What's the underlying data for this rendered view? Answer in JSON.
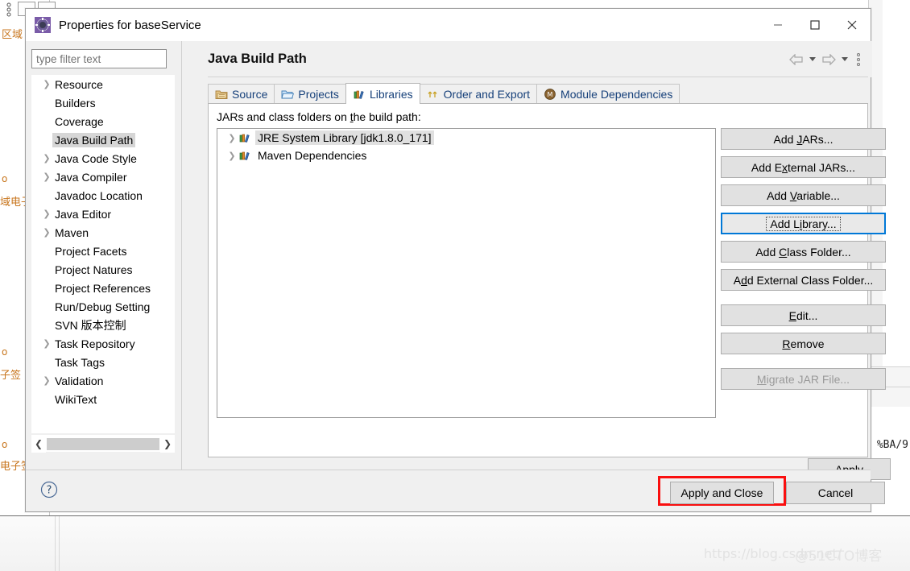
{
  "background": {
    "left_fragments": [
      "区域",
      "域电子",
      "子签",
      "电子签"
    ],
    "left_markers": [
      "o",
      "o",
      "o"
    ],
    "right_text": "%BA/9",
    "watermark": "https://blog.csdn.net/",
    "watermark_overlay": "@51CTO博客"
  },
  "dialog": {
    "title": "Properties for baseService",
    "title_icon": "properties-gear-icon",
    "window_controls": {
      "minimize": "minimize-icon",
      "maximize": "maximize-icon",
      "close": "close-icon"
    }
  },
  "sidebar": {
    "filter_placeholder": "type filter text",
    "filter_value": "",
    "items": [
      {
        "label": "Resource",
        "expandable": true,
        "selected": false
      },
      {
        "label": "Builders",
        "expandable": false,
        "selected": false
      },
      {
        "label": "Coverage",
        "expandable": false,
        "selected": false
      },
      {
        "label": "Java Build Path",
        "expandable": false,
        "selected": true
      },
      {
        "label": "Java Code Style",
        "expandable": true,
        "selected": false
      },
      {
        "label": "Java Compiler",
        "expandable": true,
        "selected": false
      },
      {
        "label": "Javadoc Location",
        "expandable": false,
        "selected": false
      },
      {
        "label": "Java Editor",
        "expandable": true,
        "selected": false
      },
      {
        "label": "Maven",
        "expandable": true,
        "selected": false
      },
      {
        "label": "Project Facets",
        "expandable": false,
        "selected": false
      },
      {
        "label": "Project Natures",
        "expandable": false,
        "selected": false
      },
      {
        "label": "Project References",
        "expandable": false,
        "selected": false
      },
      {
        "label": "Run/Debug Setting",
        "expandable": false,
        "selected": false
      },
      {
        "label": "SVN 版本控制",
        "expandable": false,
        "selected": false
      },
      {
        "label": "Task Repository",
        "expandable": true,
        "selected": false
      },
      {
        "label": "Task Tags",
        "expandable": false,
        "selected": false
      },
      {
        "label": "Validation",
        "expandable": true,
        "selected": false
      },
      {
        "label": "WikiText",
        "expandable": false,
        "selected": false
      }
    ]
  },
  "page": {
    "title": "Java Build Path",
    "nav": {
      "back": "back-arrow-icon",
      "back_menu": "chevron-down-icon",
      "forward": "forward-arrow-icon",
      "forward_menu": "chevron-down-icon",
      "overflow": "vertical-dots-icon"
    },
    "tabs": [
      {
        "label": "Source",
        "icon": "source-folder-icon",
        "active": false
      },
      {
        "label": "Projects",
        "icon": "open-folder-icon",
        "active": false
      },
      {
        "label": "Libraries",
        "icon": "library-books-icon",
        "active": true
      },
      {
        "label": "Order and Export",
        "icon": "order-arrows-icon",
        "active": false
      },
      {
        "label": "Module Dependencies",
        "icon": "module-badge-icon",
        "active": false
      }
    ],
    "list_label": "JARs and class folders on the build path:",
    "list_label_mnemonic": "t",
    "libraries": [
      {
        "label": "JRE System Library [jdk1.8.0_171]",
        "icon": "library-books-icon",
        "expandable": true,
        "selected": true
      },
      {
        "label": "Maven Dependencies",
        "icon": "library-books-icon",
        "expandable": true,
        "selected": false
      }
    ],
    "side_buttons": [
      {
        "label": "Add JARs...",
        "mnemonic": "J",
        "state": "normal",
        "gap_before": false
      },
      {
        "label": "Add External JARs...",
        "mnemonic": "x",
        "state": "normal",
        "gap_before": false
      },
      {
        "label": "Add Variable...",
        "mnemonic": "V",
        "state": "normal",
        "gap_before": false
      },
      {
        "label": "Add Library...",
        "mnemonic": "i",
        "state": "focused",
        "gap_before": false
      },
      {
        "label": "Add Class Folder...",
        "mnemonic": "C",
        "state": "normal",
        "gap_before": false
      },
      {
        "label": "Add External Class Folder...",
        "mnemonic": "d",
        "state": "normal",
        "gap_before": false
      },
      {
        "label": "Edit...",
        "mnemonic": "E",
        "state": "normal",
        "gap_before": true
      },
      {
        "label": "Remove",
        "mnemonic": "R",
        "state": "normal",
        "gap_before": false
      },
      {
        "label": "Migrate JAR File...",
        "mnemonic": "M",
        "state": "disabled",
        "gap_before": true
      }
    ],
    "apply_label": "Apply",
    "apply_mnemonic": "A"
  },
  "footer": {
    "help_icon": "help-question-icon",
    "apply_and_close": "Apply and Close",
    "cancel": "Cancel",
    "highlight_color": "#fa0f0f"
  }
}
